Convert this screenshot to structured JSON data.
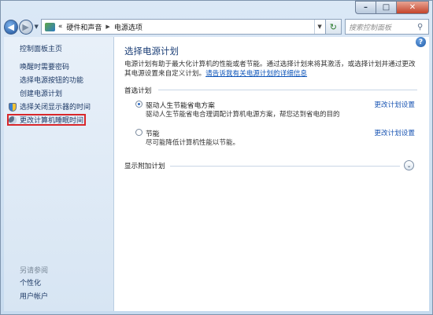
{
  "window": {
    "min_symbol": "–",
    "max_symbol": "□",
    "close_symbol": "✕"
  },
  "nav": {
    "back_symbol": "◀",
    "forward_symbol": "▶",
    "refresh_symbol": "↻",
    "breadcrumb_prefix": "«",
    "breadcrumb": [
      "硬件和声音",
      "电源选项"
    ],
    "search_placeholder": "搜索控制面板"
  },
  "sidebar": {
    "home": "控制面板主页",
    "items": [
      "唤醒时需要密码",
      "选择电源按钮的功能",
      "创建电源计划",
      "选择关闭显示器的时间",
      "更改计算机睡眠时间"
    ],
    "see_also": "另请参阅",
    "bottom_items": [
      "个性化",
      "用户帐户"
    ]
  },
  "main": {
    "help_symbol": "?",
    "title": "选择电源计划",
    "description": "电源计划有助于最大化计算机的性能或者节能。通过选择计划来将其激活，或选择计划并通过更改其电源设置来自定义计划。",
    "description_link": "请告诉我有关电源计划的详细信息",
    "preferred_label": "首选计划",
    "plans": [
      {
        "name": "驱动人生节能省电方案",
        "desc": "驱动人生节能省电合理调配计算机电源方案，帮您达到省电的目的",
        "selected": true,
        "link": "更改计划设置"
      },
      {
        "name": "节能",
        "desc": "尽可能降低计算机性能以节能。",
        "selected": false,
        "link": "更改计划设置"
      }
    ],
    "more_plans_label": "显示附加计划",
    "expand_symbol": "⌄"
  }
}
